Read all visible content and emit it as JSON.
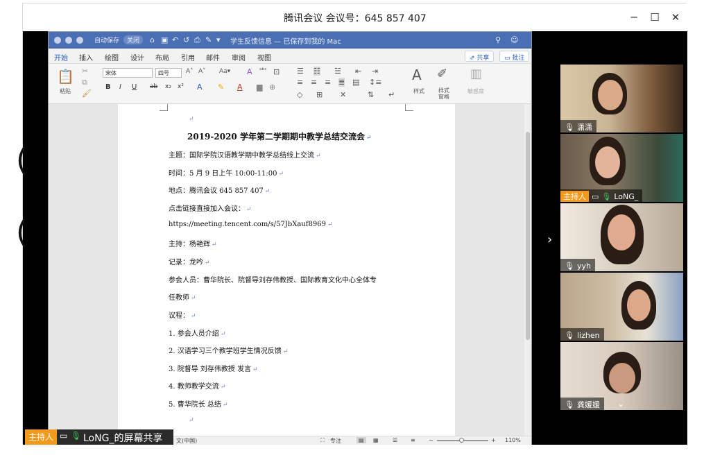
{
  "window": {
    "title": "腾讯会议 会议号：645 857 407",
    "minimize": "─",
    "maximize": "☐",
    "close": "✕"
  },
  "background_glyphs": [
    "(",
    "("
  ],
  "word": {
    "autosave": "自动保存",
    "autosave_toggle": "关闭",
    "doc_title": "学生反馈信息 — 已保存到我的 Mac",
    "tabs": [
      "开始",
      "插入",
      "绘图",
      "设计",
      "布局",
      "引用",
      "邮件",
      "审阅",
      "视图"
    ],
    "share": "共享",
    "comment": "批注",
    "ribbon": {
      "paste": "粘贴",
      "font": "宋体",
      "size": "四号",
      "styles": "样式",
      "styles_pane": "样式\n窗格",
      "sensitivity": "敏感度"
    },
    "document": {
      "title": "2019-2020 学年第二学期期中教学总结交流会",
      "lines": [
        "主题：国际学院汉语教学期中教学总结线上交流",
        "时间：5 月 9 日上午 10:00-11:00",
        "地点：腾讯会议 645 857 407",
        "点击链接直接加入会议：",
        "https://meeting.tencent.com/s/57JbXauf8969",
        "主持：杨艳辉",
        "记录：龙吟",
        "参会人员：曹华院长、院督导刘存伟教授、国际教育文化中心全体专",
        "任教师",
        "议程：",
        "1. 参会人员介绍",
        "2. 汉语学习三个教学班学生情况反馈",
        "3. 院督导  刘存伟教授  发言",
        "4. 教师教学交流",
        "5. 曹华院长  总结"
      ],
      "return_mark": "↵"
    },
    "status": {
      "lang": "文(中国)",
      "focus": "专注",
      "zoom": "110%"
    }
  },
  "share_badge": {
    "host": "主持人",
    "label": "LoNG_的屏幕共享"
  },
  "participants": [
    {
      "name": "潇潇",
      "host": false
    },
    {
      "name": "LoNG_",
      "host": true,
      "host_label": "主持人"
    },
    {
      "name": "yyh",
      "host": false
    },
    {
      "name": "lizhen",
      "host": false
    },
    {
      "name": "龚媛媛",
      "host": false
    }
  ],
  "colors": {
    "accent": "#4a6fb5",
    "host_orange": "#f39a1c",
    "mic_green": "#3ecf5a"
  }
}
